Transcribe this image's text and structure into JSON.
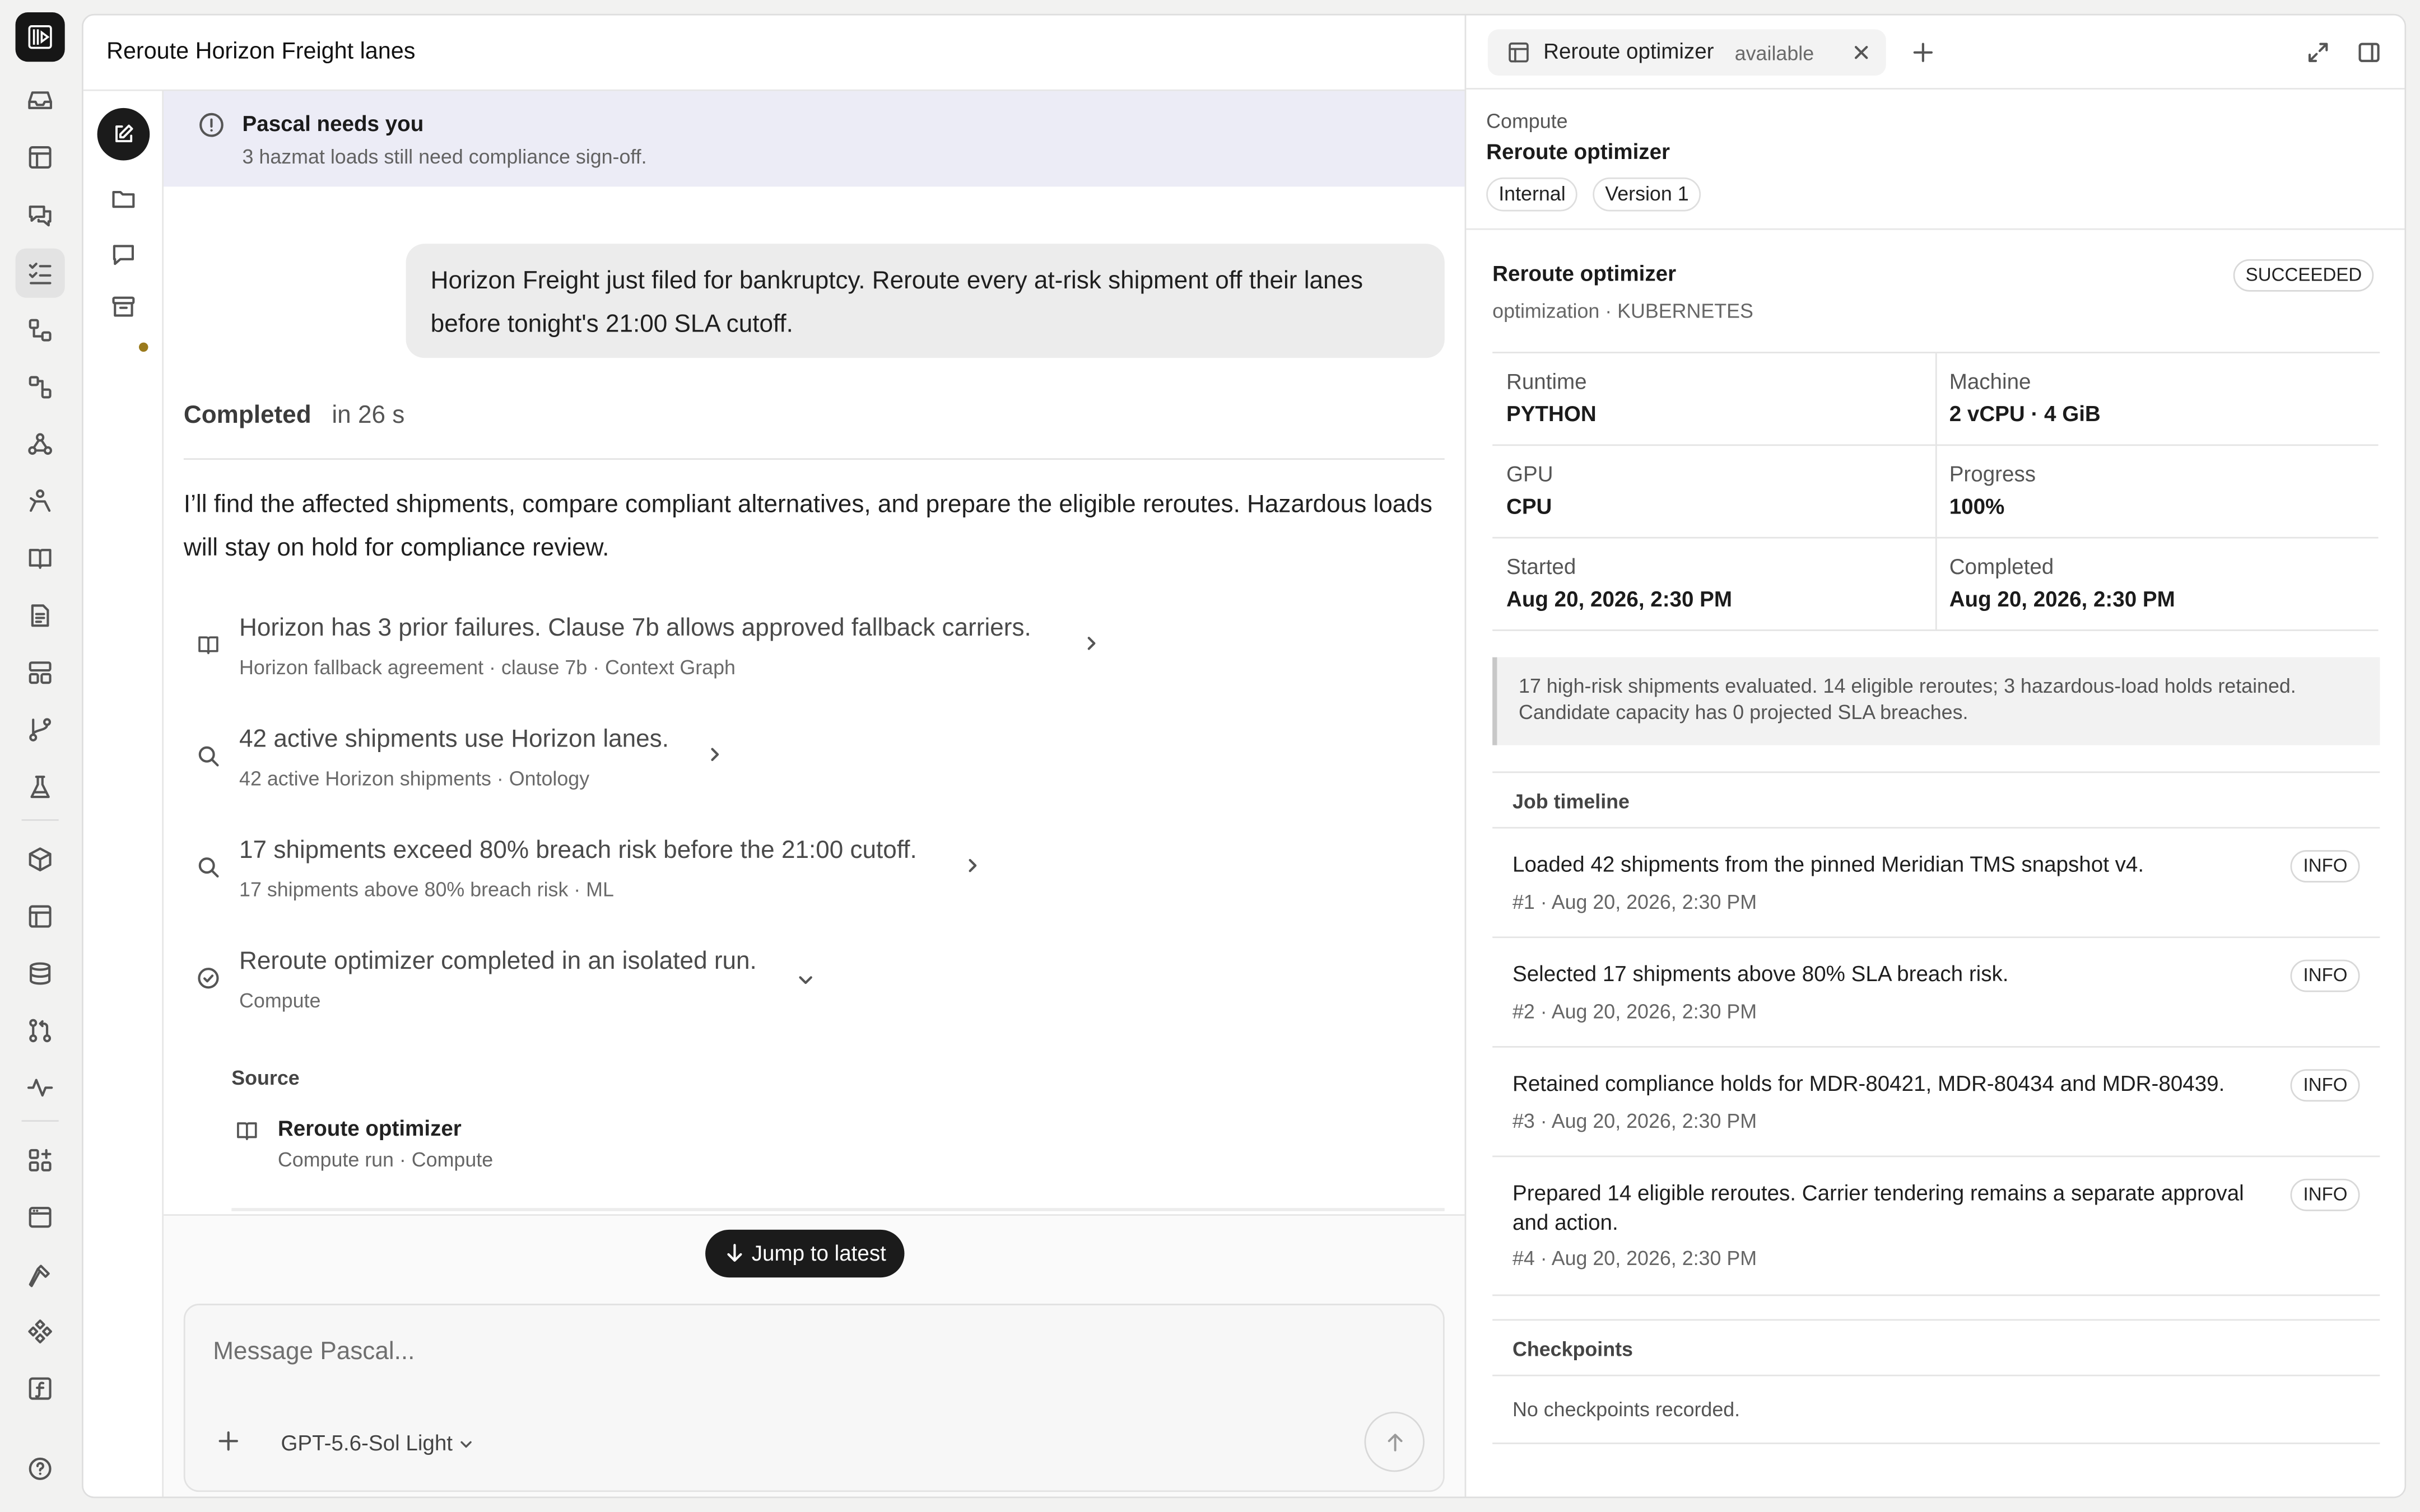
{
  "rail": {
    "items": [
      "inbox-icon",
      "table-icon",
      "chat-icon",
      "tasks-icon",
      "workflow-icon",
      "nodes-icon",
      "webhook-icon",
      "person-icon",
      "book-icon",
      "document-icon",
      "layout-icon",
      "branch-icon",
      "flask-icon",
      "package-icon",
      "panel-icon",
      "database-icon",
      "pull-request-icon",
      "activity-icon",
      "grid-plus-icon",
      "browser-icon",
      "hammer-icon",
      "components-icon",
      "function-icon",
      "help-icon"
    ]
  },
  "chat": {
    "title": "Reroute Horizon Freight lanes",
    "banner_title": "Pascal needs you",
    "banner_text": "3 hazmat loads still need compliance sign-off.",
    "user_message": "Horizon Freight just filed for bankruptcy. Reroute every at-risk shipment off their lanes before tonight's 21:00 SLA cutoff.",
    "status": "Completed",
    "duration": "in 26 s",
    "reply": "I’ll find the affected shipments, compare compliant alternatives, and prepare the eligible reroutes. Hazardous loads will stay on hold for compliance review.",
    "steps": [
      {
        "icon": "book-icon",
        "title": "Horizon has 3 prior failures. Clause 7b allows approved fallback carriers.",
        "meta": "Horizon fallback agreement · clause 7b · Context Graph",
        "expand": "chevron-right-icon"
      },
      {
        "icon": "search-icon",
        "title": "42 active shipments use Horizon lanes.",
        "meta": "42 active Horizon shipments · Ontology",
        "expand": "chevron-right-icon"
      },
      {
        "icon": "search-icon",
        "title": "17 shipments exceed 80% breach risk before the 21:00 cutoff.",
        "meta": "17 shipments above 80% breach risk · ML",
        "expand": "chevron-right-icon"
      },
      {
        "icon": "check-circle-icon",
        "title": "Reroute optimizer completed in an isolated run.",
        "meta": "Compute",
        "expand": "chevron-down-icon"
      }
    ],
    "source_label": "Source",
    "source_name": "Reroute optimizer",
    "source_meta": "Compute run · Compute",
    "jump_label": "Jump to latest",
    "placeholder": "Message Pascal...",
    "model": "GPT-5.6-Sol Light"
  },
  "panel": {
    "tab_name": "Reroute optimizer",
    "tab_status": "available",
    "kind": "Compute",
    "name": "Reroute optimizer",
    "chips": [
      "Internal",
      "Version 1"
    ],
    "job_name": "Reroute optimizer",
    "job_sub": "optimization · KUBERNETES",
    "job_status": "SUCCEEDED",
    "fields": [
      {
        "k": "Runtime",
        "v": "PYTHON"
      },
      {
        "k": "Machine",
        "v": "2 vCPU · 4 GiB"
      },
      {
        "k": "GPU",
        "v": "CPU"
      },
      {
        "k": "Progress",
        "v": "100%"
      },
      {
        "k": "Started",
        "v": "Aug 20, 2026, 2:30 PM"
      },
      {
        "k": "Completed",
        "v": "Aug 20, 2026, 2:30 PM"
      }
    ],
    "note": "17 high-risk shipments evaluated. 14 eligible reroutes; 3 hazardous-load holds retained. Candidate capacity has 0 projected SLA breaches.",
    "timeline_title": "Job timeline",
    "events": [
      {
        "msg": "Loaded 42 shipments from the pinned Meridian TMS snapshot v4.",
        "date": "#1 · Aug 20, 2026, 2:30 PM",
        "level": "INFO"
      },
      {
        "msg": "Selected 17 shipments above 80% SLA breach risk.",
        "date": "#2 · Aug 20, 2026, 2:30 PM",
        "level": "INFO"
      },
      {
        "msg": "Retained compliance holds for MDR-80421, MDR-80434 and MDR-80439.",
        "date": "#3 · Aug 20, 2026, 2:30 PM",
        "level": "INFO"
      },
      {
        "msg": "Prepared 14 eligible reroutes. Carrier tendering remains a separate approval and action.",
        "date": "#4 · Aug 20, 2026, 2:30 PM",
        "level": "INFO"
      }
    ],
    "checkpoints_title": "Checkpoints",
    "checkpoints_empty": "No checkpoints recorded."
  }
}
